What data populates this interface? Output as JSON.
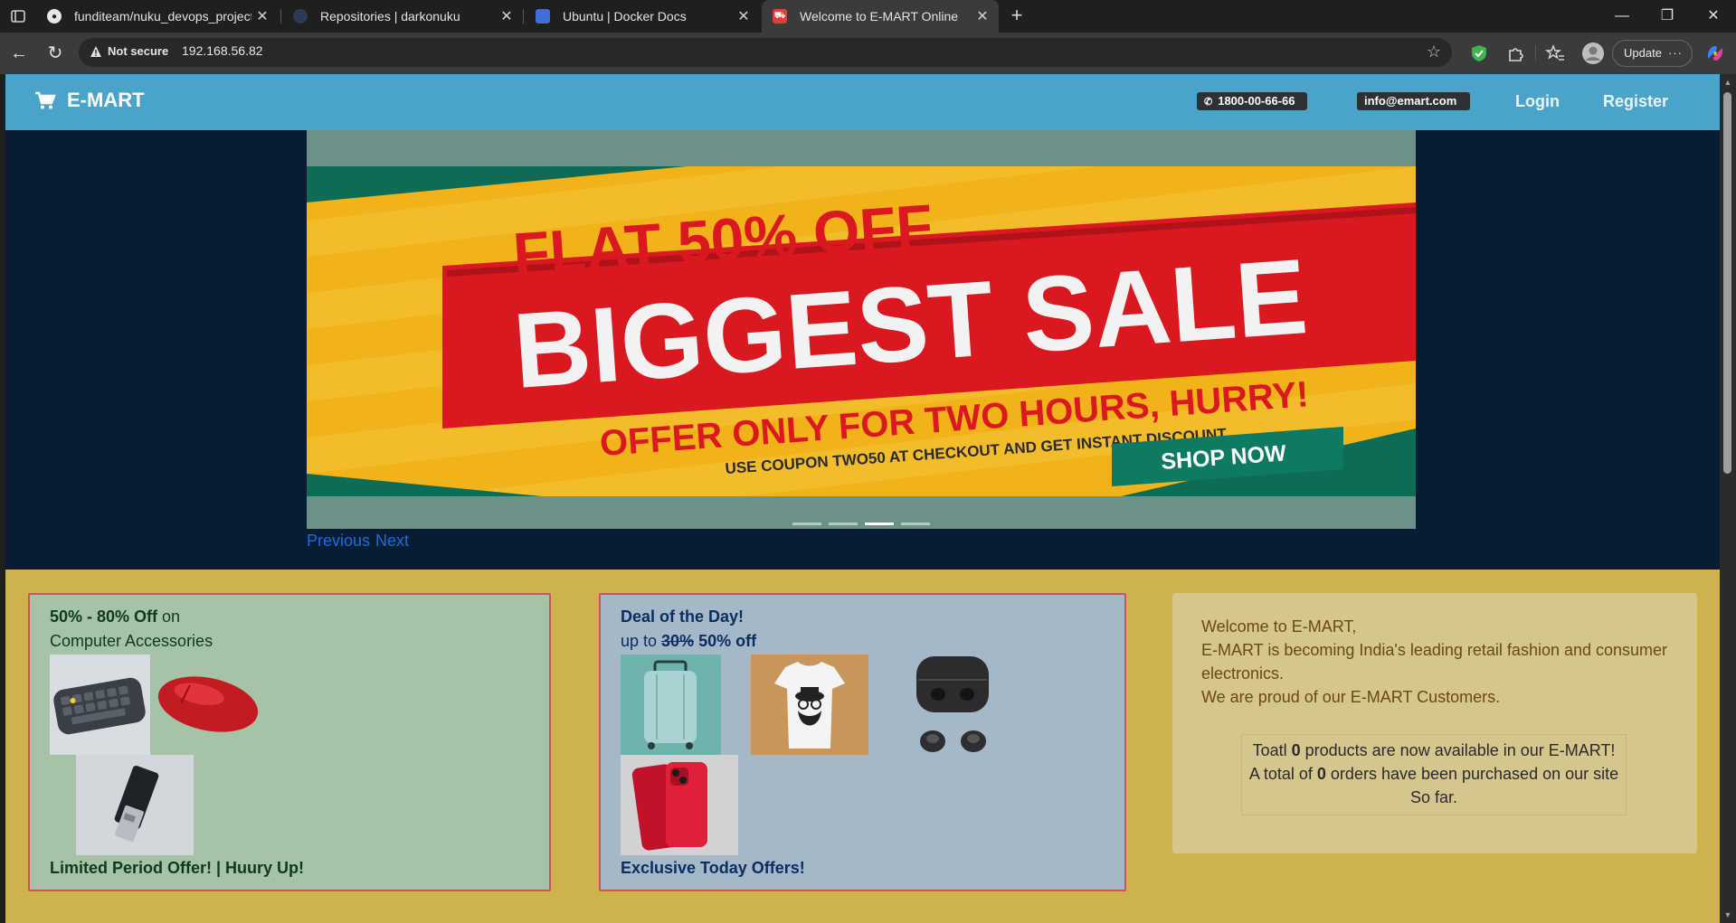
{
  "browser": {
    "tabs": [
      {
        "title": "funditeam/nuku_devops_projects",
        "favicon": "github-icon",
        "active": false
      },
      {
        "title": "Repositories | darkonuku",
        "favicon": "docker-hub-icon",
        "active": false
      },
      {
        "title": "Ubuntu | Docker Docs",
        "favicon": "docker-icon",
        "active": false
      },
      {
        "title": "Welcome to E-MART Online",
        "favicon": "cart-icon",
        "active": true
      }
    ],
    "address": {
      "security_label": "Not secure",
      "url": "192.168.56.82"
    },
    "update_label": "Update"
  },
  "site": {
    "brand": "E-MART",
    "phone": "1800-00-66-66",
    "email": "info@emart.com",
    "nav": {
      "login": "Login",
      "register": "Register"
    }
  },
  "carousel": {
    "slide": {
      "line1": "FLAT 50% OFF",
      "line2": "BIGGEST SALE",
      "line3": "OFFER ONLY FOR TWO HOURS, HURRY!",
      "line4": "USE COUPON TWO50 AT CHECKOUT AND GET INSTANT DISCOUNT",
      "cta": "SHOP NOW"
    },
    "indicator_count": 4,
    "active_indicator": 3,
    "prev_label": "Previous",
    "next_label": "Next"
  },
  "promo": {
    "card1": {
      "headline_bold": "50% - 80% Off",
      "headline_rest": " on",
      "subline": "Computer Accessories",
      "footer": "Limited Period Offer! | Huury Up!"
    },
    "card2": {
      "headline": "Deal of the Day!",
      "upto": "up to ",
      "old": "30%",
      "new": " 50% off",
      "footer": "Exclusive Today Offers!"
    },
    "card3": {
      "line1": "Welcome to E-MART,",
      "line2": "E-MART is becoming India's leading retail fashion and consumer electronics.",
      "line3": "We are proud of our E-MART Customers.",
      "stats_a1": "Toatl ",
      "stats_a2": "0",
      "stats_a3": " products are now available in our E-MART!",
      "stats_b1": "A total of ",
      "stats_b2": "0",
      "stats_b3": " orders have been purchased on our site",
      "stats_c": "So far."
    }
  },
  "colors": {
    "header": "#4aa3c8",
    "promo_bg": "#cdb24d",
    "link": "#1e6be0"
  }
}
